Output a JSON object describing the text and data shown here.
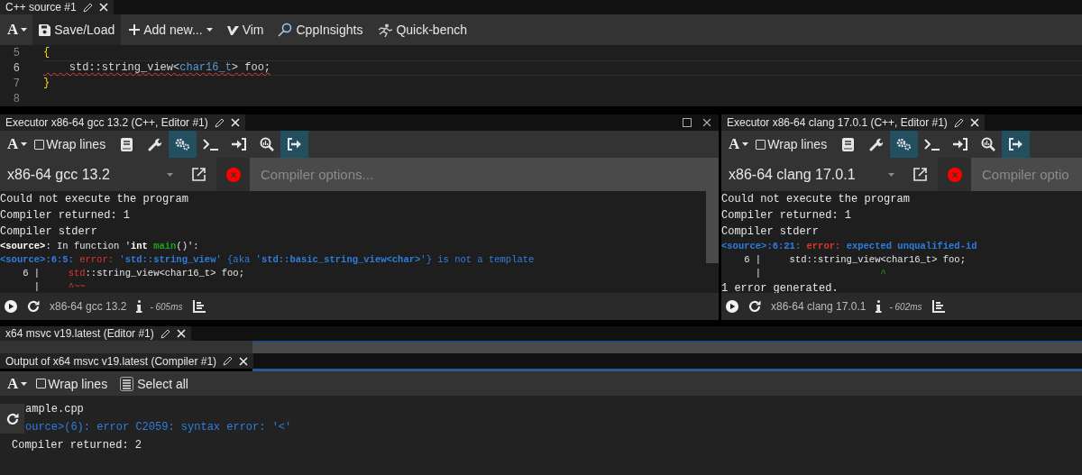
{
  "source_editor": {
    "tab": {
      "title": "C++ source #1"
    },
    "toolbar": [
      {
        "kind": "font",
        "label": "A"
      },
      {
        "kind": "button",
        "label": "Save/Load",
        "highlighted": true
      },
      {
        "kind": "dropdown",
        "label": "Add new...",
        "highlighted": false
      },
      {
        "kind": "button",
        "label": "Vim",
        "highlighted": false
      },
      {
        "kind": "button",
        "label": "CppInsights",
        "highlighted": false
      },
      {
        "kind": "button",
        "label": "Quick-bench",
        "highlighted": false
      }
    ],
    "lines": [
      {
        "number": "5",
        "current": false,
        "error": false,
        "tokens": [
          {
            "text": "{",
            "kind": "brace"
          }
        ]
      },
      {
        "number": "6",
        "current": true,
        "error": true,
        "tokens": [
          {
            "text": "    std::string_view<",
            "kind": "plain"
          },
          {
            "text": "char16_t",
            "kind": "type"
          },
          {
            "text": "> foo;",
            "kind": "plain"
          }
        ]
      },
      {
        "number": "7",
        "current": false,
        "error": false,
        "tokens": [
          {
            "text": "}",
            "kind": "brace"
          }
        ]
      },
      {
        "number": "8",
        "current": false,
        "error": false
      }
    ]
  },
  "executors": [
    {
      "tab": {
        "title": "Executor x86-64 gcc 13.2 (C++, Editor #1)"
      },
      "window_controls": true,
      "toolbar": {
        "font": "A",
        "wrap_lines": {
          "label": "Wrap lines",
          "checked": false
        },
        "buttons": [
          {
            "selected": false
          },
          {
            "selected": false
          },
          {
            "selected": true
          },
          {
            "selected": false
          },
          {
            "selected": false
          },
          {
            "selected": false
          },
          {
            "selected": true
          }
        ]
      },
      "compiler": "x86-64 gcc 13.2",
      "options_placeholder": "Compiler options...",
      "output": [
        {
          "kind": "large",
          "segments": [
            {
              "text": "Could not execute the program",
              "kind": "plain"
            }
          ]
        },
        {
          "kind": "large",
          "segments": [
            {
              "text": "Compiler returned: 1",
              "kind": "plain"
            }
          ]
        },
        {
          "kind": "large",
          "segments": [
            {
              "text": "Compiler stderr",
              "kind": "plain"
            }
          ]
        },
        {
          "kind": "small",
          "segments": [
            {
              "text": "<source>",
              "kind": "bold"
            },
            {
              "text": ": In function '",
              "kind": "plain"
            },
            {
              "text": "int ",
              "kind": "bold"
            },
            {
              "text": "main",
              "kind": "boldgreen"
            },
            {
              "text": "()':",
              "kind": "plain"
            }
          ]
        },
        {
          "kind": "small",
          "segments": [
            {
              "text": "<source>:6:5: ",
              "kind": "boldblue"
            },
            {
              "text": "error: ",
              "kind": "red"
            },
            {
              "text": "'",
              "kind": "blue"
            },
            {
              "text": "std::string_view",
              "kind": "boldblue"
            },
            {
              "text": "' {aka '",
              "kind": "blue"
            },
            {
              "text": "std::basic_string_view<char>",
              "kind": "boldblue"
            },
            {
              "text": "'} is not a template",
              "kind": "blue"
            }
          ]
        },
        {
          "kind": "small",
          "segments": [
            {
              "text": "    6 |     ",
              "kind": "plain"
            },
            {
              "text": "std",
              "kind": "red"
            },
            {
              "text": "::string_view<char16_t> foo;",
              "kind": "plain"
            }
          ]
        },
        {
          "kind": "small",
          "segments": [
            {
              "text": "      |     ",
              "kind": "plain"
            },
            {
              "text": "^~~",
              "kind": "red"
            }
          ]
        }
      ],
      "status": {
        "compiler": "x86-64 gcc 13.2",
        "time": "- 605ms"
      }
    },
    {
      "tab": {
        "title": "Executor x86-64 clang 17.0.1 (C++, Editor #1)"
      },
      "window_controls": false,
      "toolbar": {
        "font": "A",
        "wrap_lines": {
          "label": "Wrap lines",
          "checked": false
        },
        "buttons": [
          {
            "selected": false
          },
          {
            "selected": false
          },
          {
            "selected": true
          },
          {
            "selected": false
          },
          {
            "selected": false
          },
          {
            "selected": false
          },
          {
            "selected": true
          }
        ]
      },
      "compiler": "x86-64 clang 17.0.1",
      "options_placeholder": "Compiler optio",
      "output": [
        {
          "kind": "large",
          "segments": [
            {
              "text": "Could not execute the program",
              "kind": "plain"
            }
          ]
        },
        {
          "kind": "large",
          "segments": [
            {
              "text": "Compiler returned: 1",
              "kind": "plain"
            }
          ]
        },
        {
          "kind": "large",
          "segments": [
            {
              "text": "Compiler stderr",
              "kind": "plain"
            }
          ]
        },
        {
          "kind": "small",
          "segments": [
            {
              "text": "<source>:6:21: ",
              "kind": "boldblue"
            },
            {
              "text": "error: ",
              "kind": "boldred"
            },
            {
              "text": "expected unqualified-id",
              "kind": "boldblue"
            }
          ]
        },
        {
          "kind": "small",
          "segments": [
            {
              "text": "    6 |     std::string_view<char16_t> foo;",
              "kind": "plain"
            }
          ]
        },
        {
          "kind": "small",
          "segments": [
            {
              "text": "      |                     ",
              "kind": "plain"
            },
            {
              "text": "^",
              "kind": "green"
            }
          ]
        },
        {
          "kind": "large",
          "segments": [
            {
              "text": "1 error generated.",
              "kind": "plain"
            }
          ]
        }
      ],
      "status": {
        "compiler": "x86-64 clang 17.0.1",
        "time": "- 602ms"
      }
    }
  ],
  "msvc_pane": {
    "tab": {
      "title": "x64 msvc v19.latest (Editor #1)"
    },
    "output_pane": {
      "tab": {
        "title": "Output of x64 msvc v19.latest (Compiler #1)"
      },
      "toolbar": {
        "font": "A",
        "wrap_lines": {
          "label": "Wrap lines",
          "checked": false
        },
        "select_all": "Select all"
      },
      "lines": [
        {
          "indented": true,
          "segments": [
            {
              "text": "ample.cpp",
              "kind": "plain"
            }
          ]
        },
        {
          "indented": true,
          "segments": [
            {
              "text": "ource>(6): error C2059: syntax error: '<'",
              "kind": "blue"
            }
          ]
        },
        {
          "indented": false,
          "segments": [
            {
              "text": "Compiler returned: 2",
              "kind": "plain"
            }
          ]
        }
      ]
    }
  }
}
